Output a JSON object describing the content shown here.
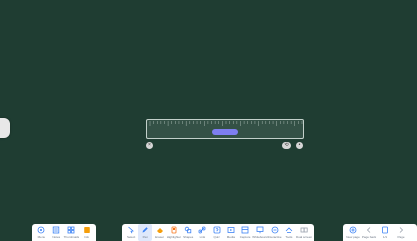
{
  "left_toolbar": {
    "items": [
      {
        "label": "Menu",
        "icon": "home-icon",
        "color": "#3b82f6"
      },
      {
        "label": "Notes",
        "icon": "notes-icon",
        "color": "#3b82f6"
      },
      {
        "label": "Thumbnails",
        "icon": "grid-icon",
        "color": "#3b82f6"
      },
      {
        "label": "Info",
        "icon": "info-icon",
        "color": "#f59e0b"
      }
    ]
  },
  "center_toolbar": {
    "items": [
      {
        "label": "Select",
        "icon": "select-icon",
        "color": "#3b82f6",
        "active": false
      },
      {
        "label": "Pen",
        "icon": "pen-icon",
        "color": "#3b82f6",
        "active": true
      },
      {
        "label": "Eraser",
        "icon": "eraser-icon",
        "color": "#f59e0b",
        "active": false
      },
      {
        "label": "Highlighter",
        "icon": "highlighter-icon",
        "color": "#f97316",
        "active": false
      },
      {
        "label": "Shapes",
        "icon": "shapes-icon",
        "color": "#3b82f6",
        "active": false
      },
      {
        "label": "Link",
        "icon": "link-icon",
        "color": "#3b82f6",
        "active": false
      },
      {
        "label": "Quiz",
        "icon": "quiz-icon",
        "color": "#3b82f6",
        "active": false
      },
      {
        "label": "Media",
        "icon": "media-icon",
        "color": "#3b82f6",
        "active": false
      },
      {
        "label": "Capture",
        "icon": "capture-icon",
        "color": "#3b82f6",
        "active": false
      },
      {
        "label": "Whiteboard",
        "icon": "whiteboard-icon",
        "color": "#3b82f6",
        "active": false
      },
      {
        "label": "Interactive",
        "icon": "interactive-icon",
        "color": "#3b82f6",
        "active": false
      },
      {
        "label": "Tools",
        "icon": "tools-icon",
        "color": "#3b82f6",
        "active": false
      },
      {
        "label": "Dual screen",
        "icon": "dual-screen-icon",
        "color": "#9ca3af",
        "active": false
      }
    ]
  },
  "right_toolbar": {
    "items": [
      {
        "label": "New page",
        "icon": "add-page-icon",
        "color": "#3b82f6"
      },
      {
        "label": "Page back",
        "icon": "chevron-left-icon",
        "color": "#9ca3af"
      },
      {
        "label": "1/1",
        "icon": "page-counter-icon",
        "color": "#3b82f6"
      },
      {
        "label": "Page",
        "icon": "chevron-right-icon",
        "color": "#9ca3af"
      }
    ]
  },
  "ruler": {
    "handle_color": "#7e7ef0",
    "tick_count": 42,
    "controls": {
      "left": "close-icon",
      "right_1": "rotate-icon",
      "right_2": "more-icon"
    }
  },
  "board": {
    "background": "#1f3d32"
  }
}
